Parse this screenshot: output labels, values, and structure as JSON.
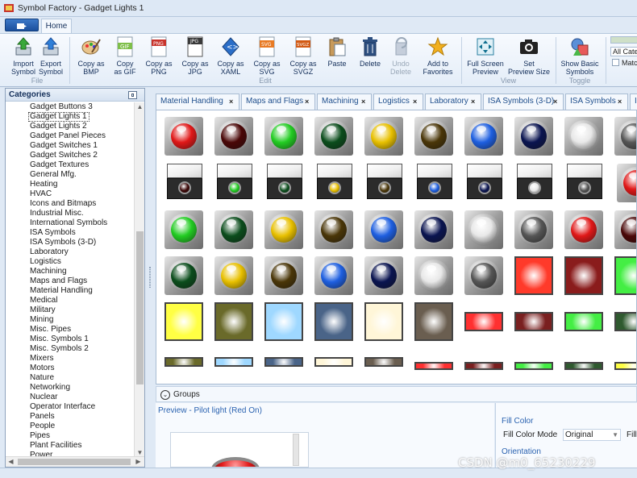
{
  "window": {
    "title": "Symbol Factory - Gadget Lights 1"
  },
  "ribbon": {
    "tab": "Home",
    "groups": [
      {
        "label": "File",
        "buttons": [
          {
            "label_1": "Import",
            "label_2": "Symbol",
            "icon": "import-icon"
          },
          {
            "label_1": "Export",
            "label_2": "Symbol",
            "icon": "export-icon"
          }
        ]
      },
      {
        "label": "Edit",
        "buttons": [
          {
            "label_1": "Copy as",
            "label_2": "BMP",
            "icon": "palette-icon"
          },
          {
            "label_1": "Copy",
            "label_2": "as GIF",
            "icon": "gif-file-icon"
          },
          {
            "label_1": "Copy as",
            "label_2": "PNG",
            "icon": "png-file-icon"
          },
          {
            "label_1": "Copy as",
            "label_2": "JPG",
            "icon": "jpg-file-icon"
          },
          {
            "label_1": "Copy as",
            "label_2": "XAML",
            "icon": "xaml-icon"
          },
          {
            "label_1": "Copy as",
            "label_2": "SVG",
            "icon": "svg-file-icon"
          },
          {
            "label_1": "Copy as",
            "label_2": "SVGZ",
            "icon": "svgz-file-icon"
          },
          {
            "label_1": "Paste",
            "label_2": "",
            "icon": "paste-icon"
          },
          {
            "label_1": "Delete",
            "label_2": "",
            "icon": "trash-icon"
          },
          {
            "label_1": "Undo",
            "label_2": "Delete",
            "icon": "undo-icon",
            "disabled": true
          },
          {
            "label_1": "Add to",
            "label_2": "Favorites",
            "icon": "star-icon"
          }
        ]
      },
      {
        "label": "View",
        "buttons": [
          {
            "label_1": "Full Screen",
            "label_2": "Preview",
            "icon": "fullscreen-icon"
          },
          {
            "label_1": "Set",
            "label_2": "Preview Size",
            "icon": "camera-icon"
          }
        ]
      },
      {
        "label": "Toggle",
        "buttons": [
          {
            "label_1": "Show Basic",
            "label_2": "Symbols",
            "icon": "shapes-icon"
          }
        ]
      }
    ],
    "category_filter": "All Cate",
    "match_label": "Matc"
  },
  "categories": {
    "header": "Categories",
    "items": [
      "Gadget Buttons 3",
      "Gadget Lights 1",
      "Gadget Lights 2",
      "Gadget Panel Pieces",
      "Gadget Switches 1",
      "Gadget Switches 2",
      "Gadget Textures",
      "General Mfg.",
      "Heating",
      "HVAC",
      "Icons and Bitmaps",
      "Industrial Misc.",
      "International Symbols",
      "ISA Symbols",
      "ISA Symbols (3-D)",
      "Laboratory",
      "Logistics",
      "Machining",
      "Maps and Flags",
      "Material Handling",
      "Medical",
      "Military",
      "Mining",
      "Misc. Pipes",
      "Misc. Symbols 1",
      "Misc. Symbols 2",
      "Mixers",
      "Motors",
      "Nature",
      "Networking",
      "Nuclear",
      "Operator Interface",
      "Panels",
      "People",
      "Pipes",
      "Plant Facilities",
      "Power"
    ],
    "selected": "Gadget Lights 1"
  },
  "doc_tabs": [
    "Material Handling",
    "Maps and Flags",
    "Machining",
    "Logistics",
    "Laboratory",
    "ISA Symbols (3-D)",
    "ISA Symbols",
    "In"
  ],
  "symbols": {
    "row1_colors": [
      "#e01818",
      "#4a0707",
      "#22cc22",
      "#0b4d1c",
      "#e8c000",
      "#4a3608",
      "#1e5fe0",
      "#0a1450",
      "#e8e8e8",
      "#555555"
    ],
    "row2_colors": [
      "#3a0606",
      "#22cc22",
      "#0b4d1c",
      "#e8c000",
      "#4a3608",
      "#1e5fe0",
      "#0a1450",
      "#e8e8e8",
      "#555555",
      "#e01818"
    ],
    "row3_colors": [
      "#22cc22",
      "#0b4d1c",
      "#e8c000",
      "#4a3608",
      "#1e5fe0",
      "#0a1450",
      "#e8e8e8",
      "#555555",
      "#e01818",
      "#4a0707"
    ],
    "row4_colors": [
      "#0b4d1c",
      "#e8c000",
      "#4a3608",
      "#1e5fe0",
      "#0a1450",
      "#e8e8e8",
      "#555555",
      "#ff3a2a",
      "#8a1c1c",
      "#44ee44"
    ],
    "row5_colors": [
      "#ffff44",
      "#6a6a2a",
      "#9fd8ff",
      "#4a6488",
      "#fff6d8",
      "#6a5e50",
      "#ff3030",
      "#7a2020",
      "#44ee44",
      "#2f5a2f"
    ],
    "row6_colors": [
      "#6a6a2a",
      "#9fd8ff",
      "#4a6488",
      "#fff6d8",
      "#6a5e50",
      "#ff3030",
      "#7a2020",
      "#44ee44",
      "#2f5a2f",
      "#ffff44"
    ]
  },
  "groups": {
    "label": "Groups"
  },
  "preview": {
    "label": "Preview - Pilot light (Red On)"
  },
  "properties": {
    "fill_color_heading": "Fill Color",
    "fill_color_mode_label": "Fill Color Mode",
    "fill_color_mode_value": "Original",
    "fill_label": "Fill",
    "orientation_heading": "Orientation"
  },
  "watermark": "CSDN @m0_65230229"
}
